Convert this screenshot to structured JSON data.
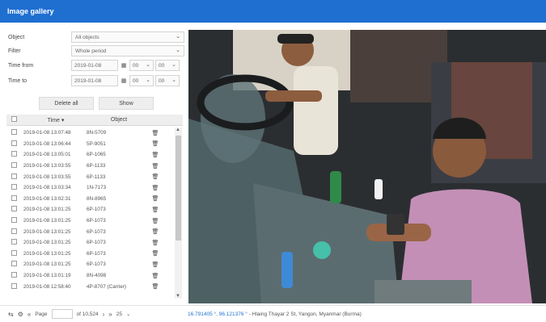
{
  "window": {
    "title": "Image gallery"
  },
  "filters": {
    "object_label": "Object",
    "object_value": "All objects",
    "filter_label": "Filter",
    "filter_value": "Whole period",
    "time_from_label": "Time from",
    "time_from_date": "2019-01-08",
    "time_from_hour": "00",
    "time_from_min": "00",
    "time_to_label": "Time to",
    "time_to_date": "2019-01-08",
    "time_to_hour": "00",
    "time_to_min": "00"
  },
  "actions": {
    "delete_all": "Delete all",
    "show": "Show"
  },
  "table": {
    "col_time": "Time",
    "col_object": "Object",
    "rows": [
      {
        "time": "2019-01-08 13:07:48",
        "object": "8N-5709"
      },
      {
        "time": "2019-01-08 13:06:44",
        "object": "5P-9051"
      },
      {
        "time": "2019-01-08 13:05:01",
        "object": "6P-1065"
      },
      {
        "time": "2019-01-08 13:03:55",
        "object": "6P-1133"
      },
      {
        "time": "2019-01-08 13:03:55",
        "object": "6P-1133"
      },
      {
        "time": "2019-01-08 13:03:34",
        "object": "1N-7173"
      },
      {
        "time": "2019-01-08 13:02:31",
        "object": "8N-8965"
      },
      {
        "time": "2019-01-08 13:01:25",
        "object": "6P-1073"
      },
      {
        "time": "2019-01-08 13:01:25",
        "object": "6P-1073"
      },
      {
        "time": "2019-01-08 13:01:25",
        "object": "6P-1073"
      },
      {
        "time": "2019-01-08 13:01:25",
        "object": "6P-1073"
      },
      {
        "time": "2019-01-08 13:01:25",
        "object": "6P-1073"
      },
      {
        "time": "2019-01-08 13:01:25",
        "object": "6P-1073"
      },
      {
        "time": "2019-01-08 13:01:19",
        "object": "8N-4098"
      },
      {
        "time": "2019-01-08 12:58:40",
        "object": "4P-8707 (Carrier)"
      }
    ]
  },
  "footer": {
    "page_label": "Page",
    "page_of": "of 10,524",
    "page_size": "25",
    "coords": "16.791405 °, 96.121376 °",
    "location": " - Hlaing Thayar 2 St, Yangon, Myanmar (Burma)"
  },
  "icons": {
    "refresh": "refresh-icon",
    "settings": "settings-icon",
    "calendar": "calendar-icon",
    "trash": "trash-icon"
  },
  "colors": {
    "accent": "#1f6fd1",
    "link": "#1f6fd1"
  }
}
